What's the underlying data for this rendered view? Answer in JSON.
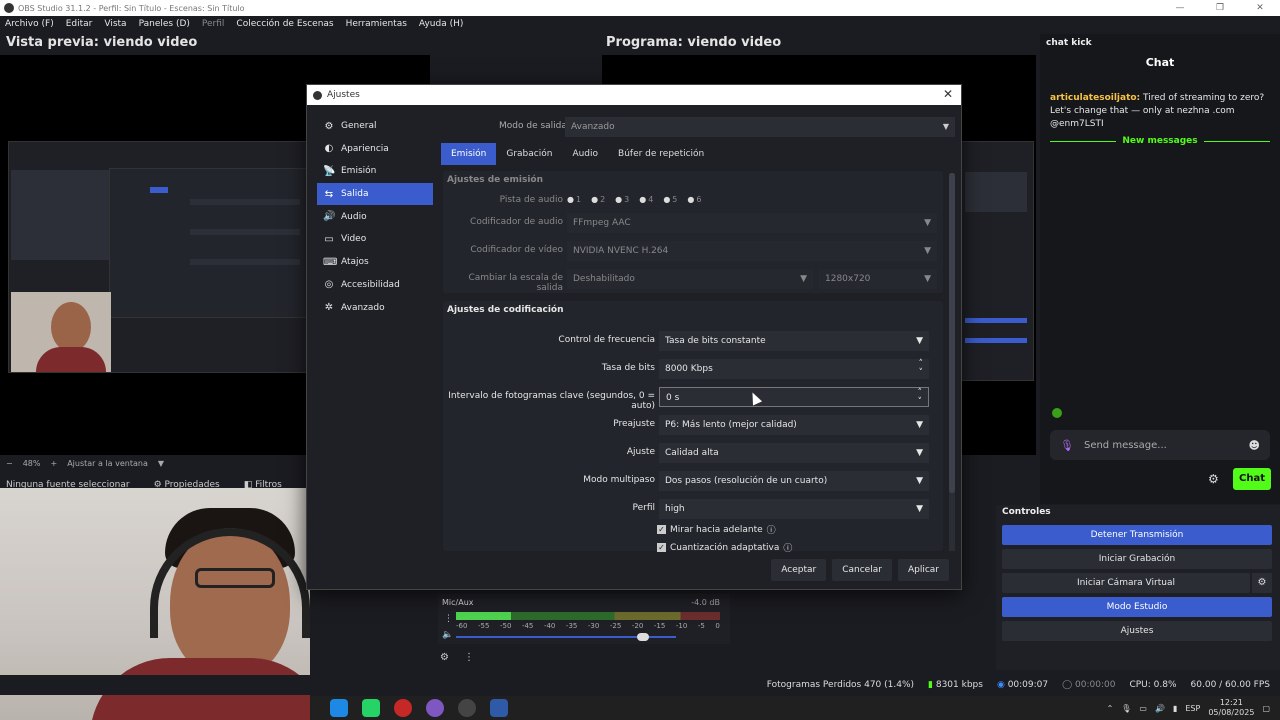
{
  "window": {
    "title": "OBS Studio 31.1.2 - Perfil: Sin Título - Escenas: Sin Título",
    "controls": [
      "—",
      "❐",
      "✕"
    ]
  },
  "menu": [
    "Archivo (F)",
    "Editar",
    "Vista",
    "Paneles (D)",
    "Perfil",
    "Colección de Escenas",
    "Herramientas",
    "Ayuda (H)"
  ],
  "preview": {
    "title": "Vista previa: viendo video",
    "zoom": "48%",
    "fit_label": "Ajustar a la ventana",
    "no_source": "Ninguna fuente seleccionar",
    "properties": "Propiedades",
    "filters": "Filtros"
  },
  "program": {
    "title": "Programa: viendo video"
  },
  "chat": {
    "dock_title": "chat kick",
    "header": "Chat",
    "message": {
      "user": "articulatesoiljato:",
      "text": " Tired of streaming to zero? Let's change that — only at nezhna .com @enm7LSTI"
    },
    "new_messages": "New messages",
    "placeholder": "Send message...",
    "send_label": "Chat",
    "accent": "#53fc18"
  },
  "controls": {
    "dock_title": "Controles",
    "buttons": [
      "Detener Transmisión",
      "Iniciar Grabación",
      "Iniciar Cámara Virtual",
      "Modo Estudio",
      "Ajustes"
    ]
  },
  "mixer": {
    "label": "Mic/Aux",
    "db": "-4.0 dB",
    "level_fraction": 0.21,
    "volume_fraction": 0.85,
    "scale": [
      "-60",
      "-55",
      "-50",
      "-45",
      "-40",
      "-35",
      "-30",
      "-25",
      "-20",
      "-15",
      "-10",
      "-5",
      "0"
    ]
  },
  "status": {
    "dropped": "Fotogramas Perdidos 470 (1.4%)",
    "bitrate": "8301 kbps",
    "stream_time": "00:09:07",
    "rec_time": "00:00:00",
    "cpu": "CPU: 0.8%",
    "fps": "60.00 / 60.00 FPS"
  },
  "taskbar": {
    "lang": "ESP",
    "time": "12:21",
    "date": "05/08/2025"
  },
  "dialog": {
    "title": "Ajustes",
    "nav": [
      {
        "icon": "⚙",
        "label": "General"
      },
      {
        "icon": "◐",
        "label": "Apariencia"
      },
      {
        "icon": "📡",
        "label": "Emisión"
      },
      {
        "icon": "⇆",
        "label": "Salida"
      },
      {
        "icon": "🔊",
        "label": "Audio"
      },
      {
        "icon": "▭",
        "label": "Video"
      },
      {
        "icon": "⌨",
        "label": "Atajos"
      },
      {
        "icon": "◎",
        "label": "Accesibilidad"
      },
      {
        "icon": "✲",
        "label": "Avanzado"
      }
    ],
    "active_nav": "Salida",
    "mode_label": "Modo de salida",
    "mode_value": "Avanzado",
    "tabs": [
      "Emisión",
      "Grabación",
      "Audio",
      "Búfer de repetición"
    ],
    "active_tab": "Emisión",
    "emission": {
      "title": "Ajustes de emisión",
      "audio_track_label": "Pista de audio",
      "audio_tracks": [
        "1",
        "2",
        "3",
        "4",
        "5",
        "6"
      ],
      "audio_encoder_label": "Codificador de audio",
      "audio_encoder": "FFmpeg AAC",
      "video_encoder_label": "Codificador de vídeo",
      "video_encoder": "NVIDIA NVENC H.264",
      "rescale_label": "Cambiar la escala de salida",
      "rescale": "Deshabilitado",
      "resolution": "1280x720"
    },
    "encoding": {
      "title": "Ajustes de codificación",
      "rate_control_label": "Control de frecuencia",
      "rate_control": "Tasa de bits constante",
      "bitrate_label": "Tasa de bits",
      "bitrate": "8000 Kbps",
      "keyframe_label": "Intervalo de fotogramas clave (segundos, 0 = auto)",
      "keyframe": "0 s",
      "preset_label": "Preajuste",
      "preset": "P6: Más lento (mejor calidad)",
      "tuning_label": "Ajuste",
      "tuning": "Calidad alta",
      "multipass_label": "Modo multipaso",
      "multipass": "Dos pasos (resolución de un cuarto)",
      "profile_label": "Perfil",
      "profile": "high",
      "lookahead_label": "Mirar hacia adelante",
      "aq_label": "Cuantización adaptativa"
    },
    "buttons": {
      "accept": "Aceptar",
      "cancel": "Cancelar",
      "apply": "Aplicar"
    }
  }
}
